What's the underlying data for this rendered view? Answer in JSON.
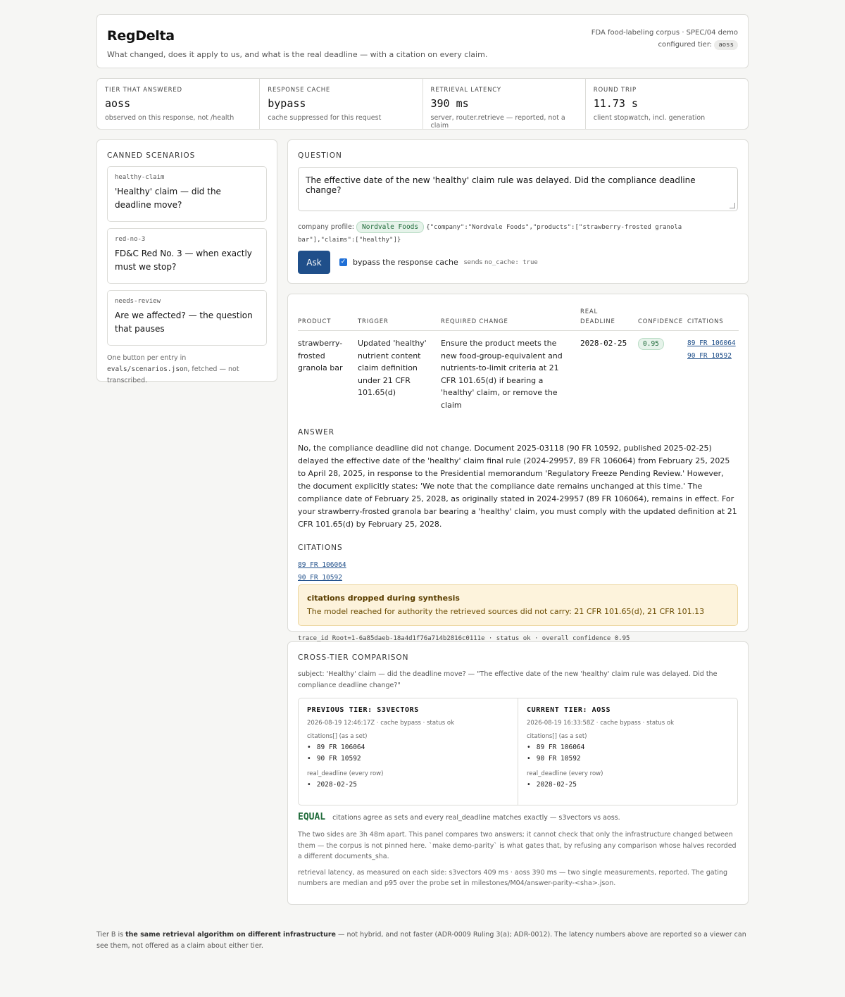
{
  "header": {
    "title": "RegDelta",
    "tagline": "What changed, does it apply to us, and what is the real deadline — with a citation on every claim.",
    "corpus": "FDA food-labeling corpus · SPEC/04 demo",
    "configured_tier_label": "configured tier:",
    "configured_tier": "aoss"
  },
  "stats": [
    {
      "label": "TIER THAT ANSWERED",
      "value": "aoss",
      "sub": "observed on this response, not /health"
    },
    {
      "label": "RESPONSE CACHE",
      "value": "bypass",
      "sub": "cache suppressed for this request"
    },
    {
      "label": "RETRIEVAL LATENCY",
      "value": "390 ms",
      "sub": "server, router.retrieve — reported, not a claim"
    },
    {
      "label": "ROUND TRIP",
      "value": "11.73 s",
      "sub": "client stopwatch, incl. generation"
    }
  ],
  "scenarios": {
    "heading": "CANNED SCENARIOS",
    "items": [
      {
        "slug": "healthy-claim",
        "question": "'Healthy' claim — did the deadline move?"
      },
      {
        "slug": "red-no-3",
        "question": "FD&C Red No. 3 — when exactly must we stop?"
      },
      {
        "slug": "needs-review",
        "question": "Are we affected? — the question that pauses"
      }
    ],
    "foot_pre": "One button per entry in ",
    "foot_file": "evals/scenarios.json",
    "foot_post": ", fetched — not transcribed."
  },
  "question": {
    "heading": "QUESTION",
    "text": "The effective date of the new 'healthy' claim rule was delayed. Did the compliance deadline change?",
    "profile_label": "company profile:",
    "company": "Nordvale Foods",
    "profile_json": "{\"company\":\"Nordvale Foods\",\"products\":[\"strawberry-frosted granola bar\"],\"claims\":[\"healthy\"]}",
    "ask_label": "Ask",
    "bypass_label": "bypass the response cache",
    "bypass_hint_pre": "sends ",
    "bypass_hint_code": "no_cache: true"
  },
  "results": {
    "columns": [
      "PRODUCT",
      "TRIGGER",
      "REQUIRED CHANGE",
      "REAL DEADLINE",
      "CONFIDENCE",
      "CITATIONS"
    ],
    "row": {
      "product": "strawberry-frosted granola bar",
      "trigger": "Updated 'healthy' nutrient content claim definition under 21 CFR 101.65(d)",
      "required_change": "Ensure the product meets the new food-group-equivalent and nutrients-to-limit criteria at 21 CFR 101.65(d) if bearing a 'healthy' claim, or remove the claim",
      "deadline": "2028-02-25",
      "confidence": "0.95",
      "citations": [
        "89 FR 106064",
        "90 FR 10592"
      ]
    },
    "answer_heading": "ANSWER",
    "answer": "No, the compliance deadline did not change. Document 2025-03118 (90 FR 10592, published 2025-02-25) delayed the effective date of the 'healthy' claim final rule (2024-29957, 89 FR 106064) from February 25, 2025 to April 28, 2025, in response to the Presidential memorandum 'Regulatory Freeze Pending Review.' However, the document explicitly states: 'We note that the compliance date remains unchanged at this time.' The compliance date of February 25, 2028, as originally stated in 2024-29957 (89 FR 106064), remains in effect. For your strawberry-frosted granola bar bearing a 'healthy' claim, you must comply with the updated definition at 21 CFR 101.65(d) by February 25, 2028.",
    "citations_heading": "CITATIONS",
    "citations": [
      "89 FR 106064",
      "90 FR 10592"
    ],
    "warning_title": "citations dropped during synthesis",
    "warning_text": "The model reached for authority the retrieved sources did not carry: 21 CFR 101.65(d), 21 CFR 101.13",
    "trace": "trace_id Root=1-6a85daeb-18a4d1f76a714b2816c0111e · status ok · overall confidence 0.95"
  },
  "cross": {
    "heading": "CROSS-TIER COMPARISON",
    "subject": "subject: 'Healthy' claim — did the deadline move? — \"The effective date of the new 'healthy' claim rule was delayed. Did the compliance deadline change?\"",
    "previous": {
      "title": "PREVIOUS TIER: S3VECTORS",
      "meta": "2026-08-19 12:46:17Z · cache bypass · status ok",
      "citations_label": "citations[] (as a set)",
      "citations": [
        "89 FR 106064",
        "90 FR 10592"
      ],
      "deadline_label": "real_deadline (every row)",
      "deadlines": [
        "2028-02-25"
      ]
    },
    "current": {
      "title": "CURRENT TIER: AOSS",
      "meta": "2026-08-19 16:33:58Z · cache bypass · status ok",
      "citations_label": "citations[] (as a set)",
      "citations": [
        "89 FR 106064",
        "90 FR 10592"
      ],
      "deadline_label": "real_deadline (every row)",
      "deadlines": [
        "2028-02-25"
      ]
    },
    "verdict": "EQUAL",
    "verdict_detail": "citations agree as sets and every real_deadline matches exactly — s3vectors vs aoss.",
    "note1": "The two sides are 3h 48m apart. This panel compares two answers; it cannot check that only the infrastructure changed between them — the corpus is not pinned here. `make demo-parity` is what gates that, by refusing any comparison whose halves recorded a different documents_sha.",
    "note2": "retrieval latency, as measured on each side: s3vectors 409 ms · aoss 390 ms — two single measurements, reported. The gating numbers are median and p95 over the probe set in milestones/M04/answer-parity-<sha>.json."
  },
  "footer": {
    "pre": "Tier B is ",
    "bold": "the same retrieval algorithm on different infrastructure",
    "post": " — not hybrid, and not faster (ADR-0009 Ruling 3(a); ADR-0012). The latency numbers above are reported so a viewer can see them, not offered as a claim about either tier."
  }
}
